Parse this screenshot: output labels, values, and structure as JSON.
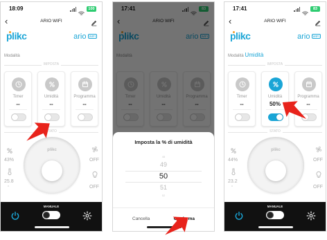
{
  "colors": {
    "accent": "#1aa5d6",
    "arrow": "#e8231b",
    "battery": "#2ecc71",
    "icon_inactive": "#c9c9c9",
    "bottom_bar": "#111111"
  },
  "screens": [
    {
      "id": "p1",
      "status_time": "18:09",
      "battery": "100",
      "app_title": "ARIO WIFI",
      "brand": "plikc",
      "model": "ario",
      "model_badge": "WIFI",
      "mode_label": "Modalità",
      "mode_value": "",
      "imposta_label": "IMPOSTA",
      "cards": [
        {
          "label": "Timer",
          "value": "--",
          "icon": "clock-icon",
          "active": false,
          "toggle_on": false
        },
        {
          "label": "Umidità",
          "value": "--",
          "icon": "humidity-icon",
          "active": false,
          "toggle_on": false
        },
        {
          "label": "Programma",
          "value": "--",
          "icon": "calendar-icon",
          "active": false,
          "toggle_on": false
        }
      ],
      "stato_label": "STATO",
      "humidity": "43%",
      "temperature": "25.8",
      "temp_unit": "°",
      "fan_status": "OFF",
      "light_status": "OFF",
      "dial_brand": "plikc",
      "manuale_label": "MANUALE"
    },
    {
      "id": "p2",
      "status_time": "17:41",
      "battery": "83",
      "app_title": "ARIO WIFI",
      "brand": "plikc",
      "model": "ario",
      "model_badge": "WIFI",
      "mode_label": "Modalità",
      "mode_value": "",
      "cards": [
        {
          "label": "Timer",
          "value": "--",
          "icon": "clock-icon",
          "active": false,
          "toggle_on": false
        },
        {
          "label": "Umidità",
          "value": "--",
          "icon": "humidity-icon",
          "active": false,
          "toggle_on": false
        },
        {
          "label": "Programma",
          "value": "--",
          "icon": "calendar-icon",
          "active": false,
          "toggle_on": false
        }
      ],
      "dialog": {
        "title": "Imposta la % di umidità",
        "options": [
          "48",
          "49",
          "50",
          "51",
          "52"
        ],
        "selected": "50",
        "cancel": "Cancella",
        "confirm": "Conferma"
      }
    },
    {
      "id": "p3",
      "status_time": "17:41",
      "battery": "83",
      "app_title": "ARIO WIFI",
      "brand": "plikc",
      "model": "ario",
      "model_badge": "WIFI",
      "mode_label": "Modalità",
      "mode_value": "Umidità",
      "imposta_label": "IMPOSTA",
      "cards": [
        {
          "label": "Timer",
          "value": "--",
          "icon": "clock-icon",
          "active": false,
          "toggle_on": false
        },
        {
          "label": "Umidità",
          "value": "50%",
          "icon": "humidity-icon",
          "active": true,
          "toggle_on": true
        },
        {
          "label": "Programma",
          "value": "--",
          "icon": "calendar-icon",
          "active": false,
          "toggle_on": false
        }
      ],
      "stato_label": "STATO",
      "humidity": "44%",
      "temperature": "23.2",
      "temp_unit": "°",
      "fan_status": "OFF",
      "light_status": "OFF",
      "dial_brand": "plikc",
      "manuale_label": "MANUALE"
    }
  ]
}
